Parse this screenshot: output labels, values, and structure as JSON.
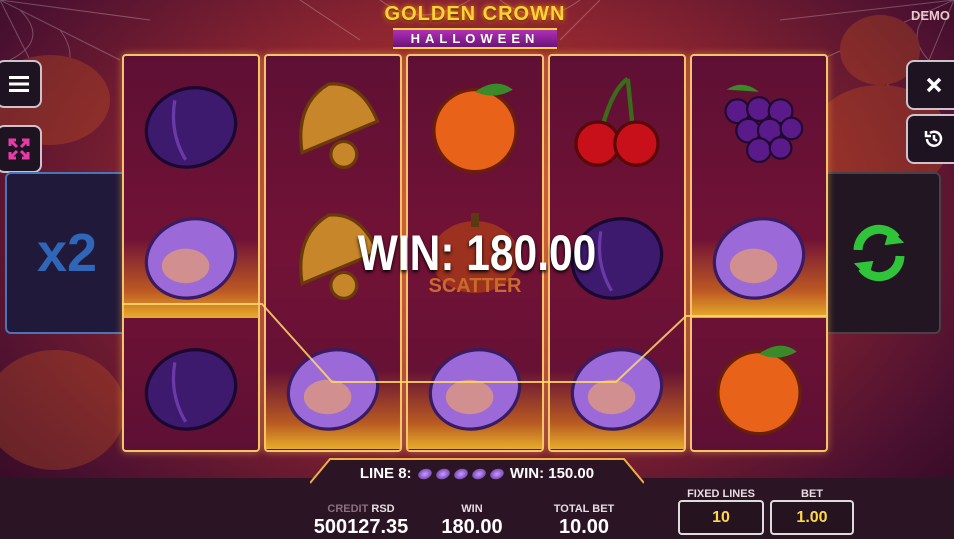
{
  "header": {
    "logo_line1": "GOLDEN CROWN",
    "logo_line2": "HALLOWEEN",
    "mode": "DEMO"
  },
  "grid": [
    [
      "plum",
      "plum",
      "plum"
    ],
    [
      "bell",
      "bell",
      "plum"
    ],
    [
      "orange",
      "scatter",
      "plum"
    ],
    [
      "cherry",
      "plum",
      "plum"
    ],
    [
      "grapes",
      "plum",
      "orange"
    ]
  ],
  "scatter_label": "SCATTER",
  "win_banner": "WIN: 180.00",
  "multiplier": "x2",
  "line_win": {
    "line": "LINE 8:",
    "win": "WIN: 150.00"
  },
  "footer": {
    "credit_label": "CREDIT",
    "currency": "RSD",
    "credit_value": "500127.35",
    "win_label": "WIN",
    "win_value": "180.00",
    "total_bet_label": "TOTAL BET",
    "total_bet_value": "10.00",
    "fixed_lines_label": "FIXED LINES",
    "fixed_lines_value": "10",
    "bet_label": "BET",
    "bet_value": "1.00"
  },
  "icons": {
    "menu": "menu-icon",
    "fullscreen": "fullscreen-icon",
    "close": "close-icon",
    "history": "history-icon",
    "spin": "spin-icon"
  },
  "colors": {
    "gold": "#f3c56a",
    "spin_green": "#2fc43a",
    "x2_blue": "#2f66b8"
  }
}
